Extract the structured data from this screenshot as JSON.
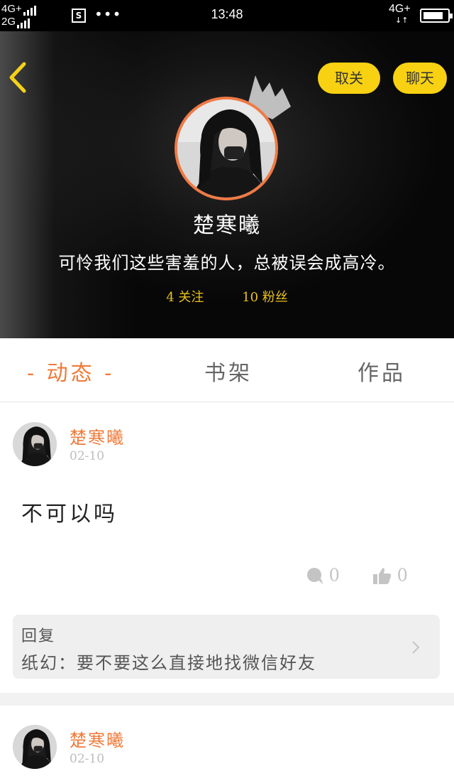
{
  "status_bar": {
    "network_left_top": "4G+",
    "network_left_bottom": "2G",
    "sim_icon_label": "S",
    "more_dots": "•••",
    "time": "13:48",
    "network_right": "4G+",
    "battery_level": 0.85
  },
  "profile": {
    "back_icon": "chevron-left-icon",
    "unfollow_label": "取关",
    "chat_label": "聊天",
    "name": "楚寒曦",
    "bio": "可怜我们这些害羞的人，总被误会成高冷。",
    "following": "4 关注",
    "followers": "10 粉丝",
    "accent_color": "#f7d112"
  },
  "tabs": [
    {
      "label": "- 动态 -",
      "active": true
    },
    {
      "label": "书架",
      "active": false
    },
    {
      "label": "作品",
      "active": false
    }
  ],
  "posts": [
    {
      "author": "楚寒曦",
      "date": "02-10",
      "content": "不可以吗",
      "comments": "0",
      "likes": "0",
      "reply_label": "回复",
      "reply_text": "纸幻：要不要这么直接地找微信好友"
    },
    {
      "author": "楚寒曦",
      "date": "02-10"
    }
  ],
  "colors": {
    "orange": "#f07a3a",
    "gray_text": "#bdbdbd"
  }
}
